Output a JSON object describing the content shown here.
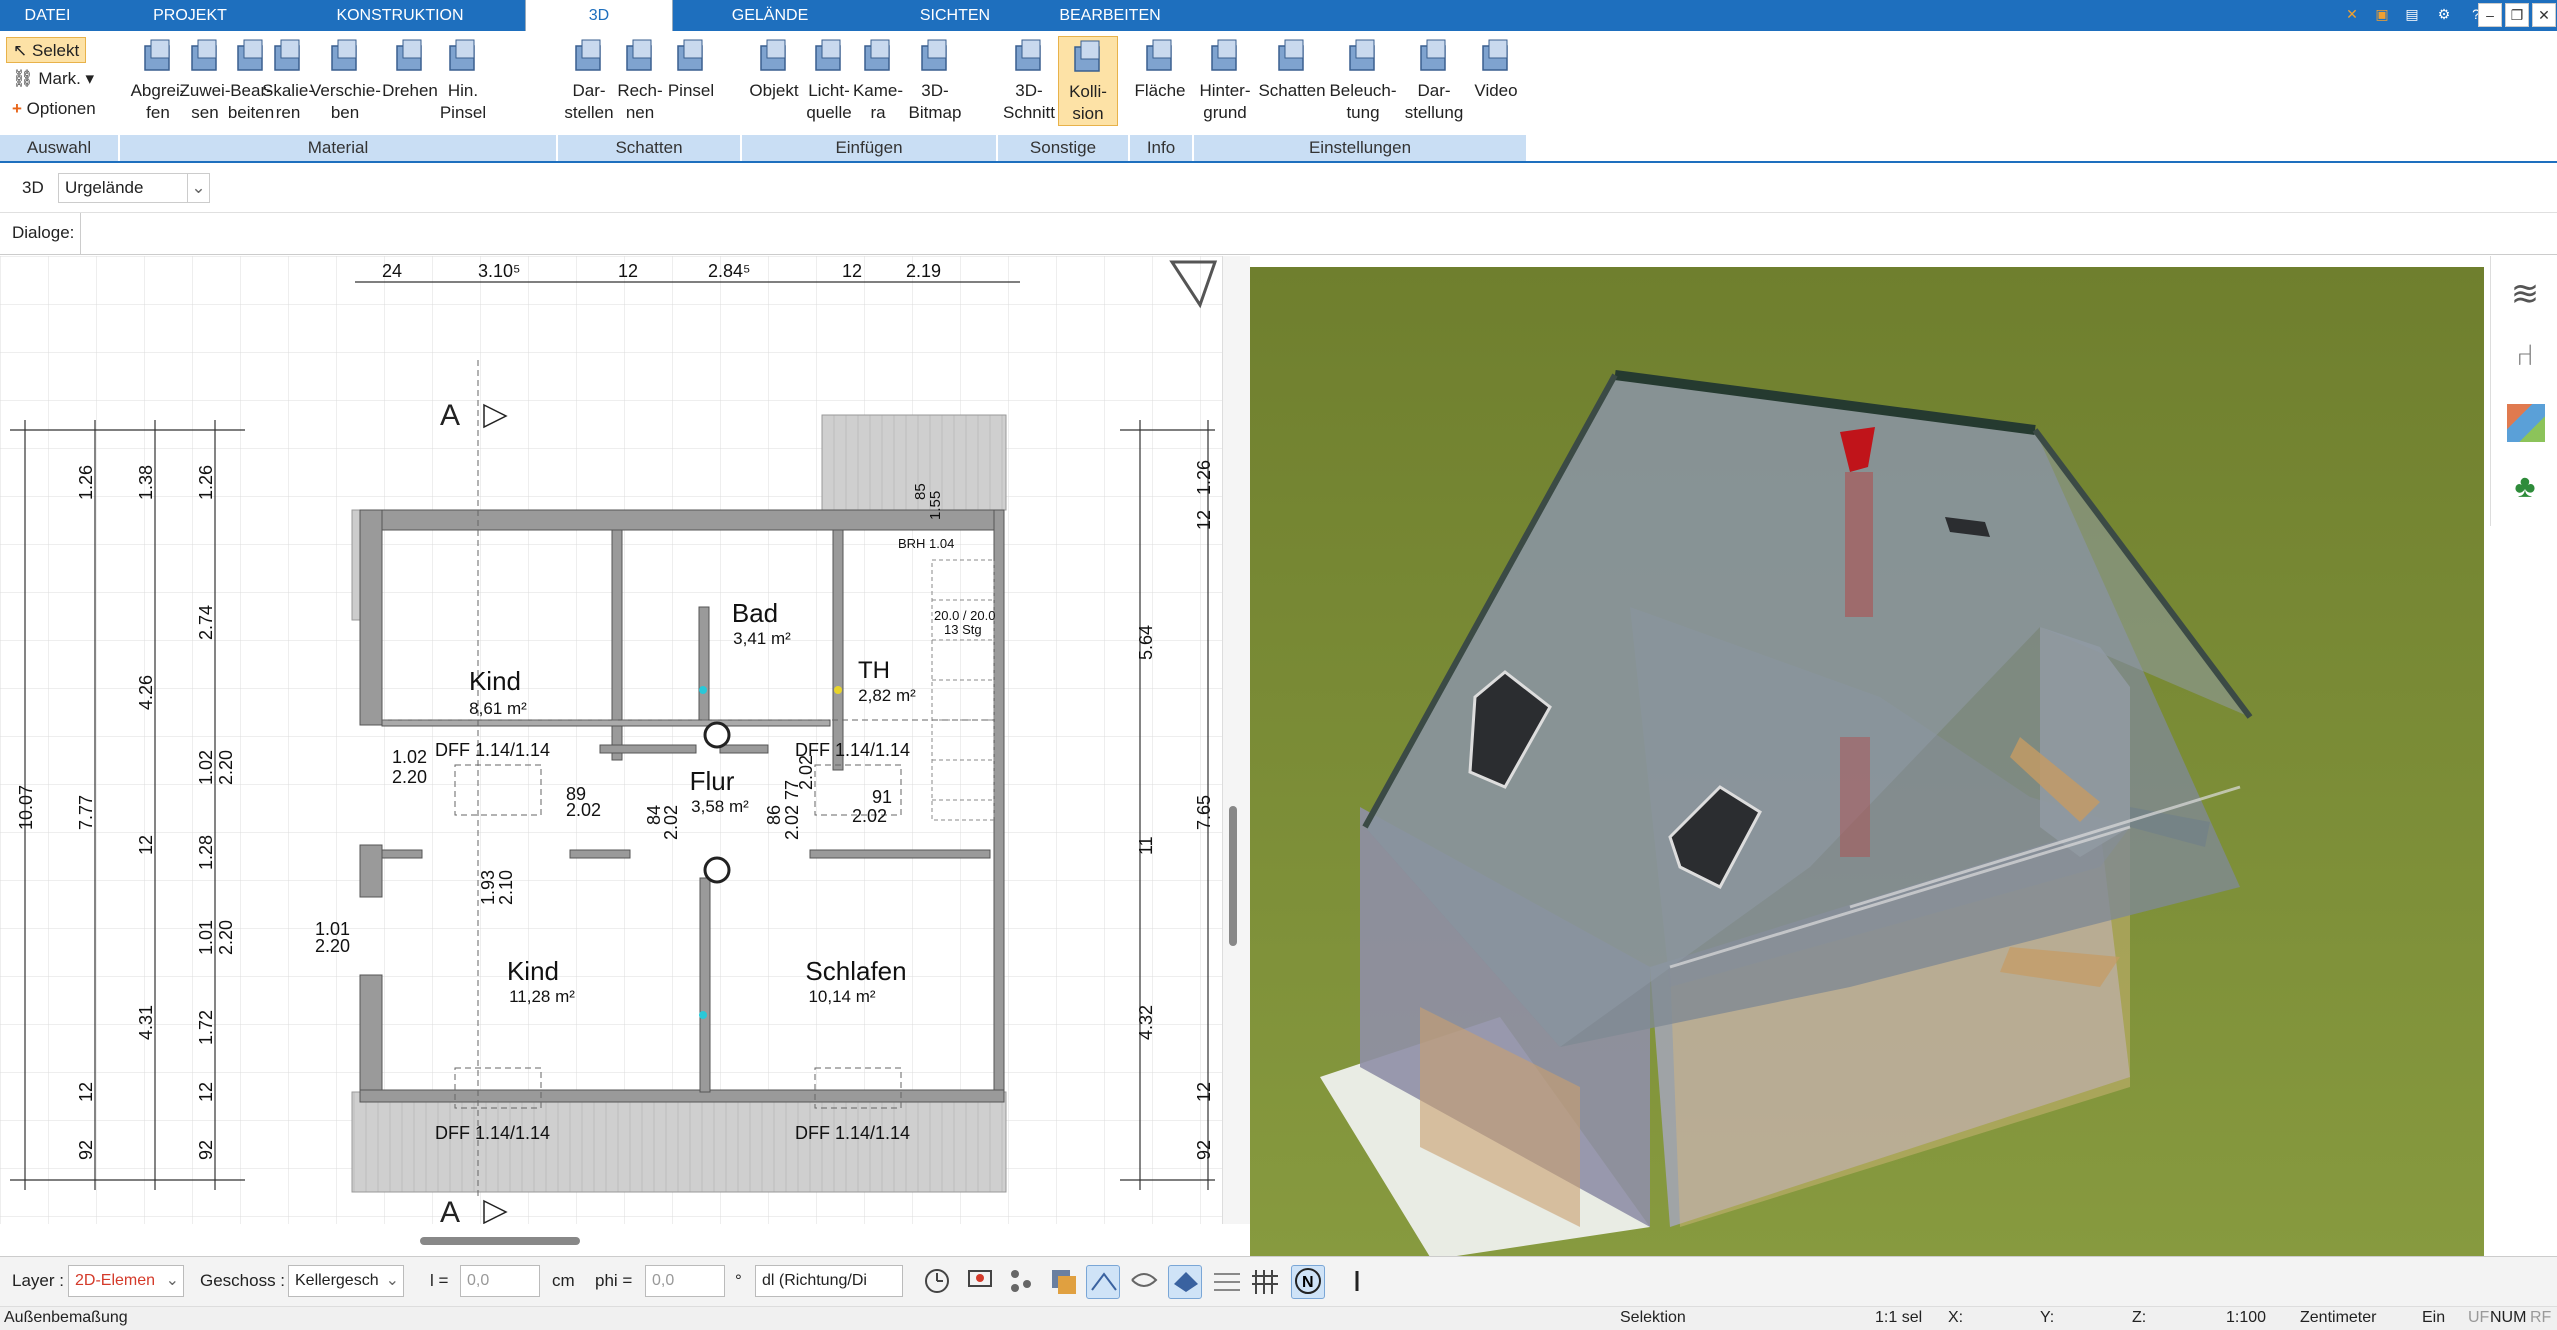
{
  "menubar": {
    "tabs": [
      "DATEI",
      "PROJEKT",
      "KONSTRUKTION",
      "3D",
      "GELÄNDE",
      "SICHTEN",
      "BEARBEITEN"
    ],
    "active": "3D"
  },
  "ribbon": {
    "selection": {
      "select": "Selekt",
      "mark": "Mark.",
      "options": "Optionen"
    },
    "buttons": [
      {
        "label1": "Abgrei-",
        "label2": "fen",
        "icon": "pick-material-icon"
      },
      {
        "label1": "Zuwei-",
        "label2": "sen",
        "icon": "assign-material-icon"
      },
      {
        "label1": "Bear-",
        "label2": "beiten",
        "icon": "edit-material-icon"
      },
      {
        "label1": "Skalie-",
        "label2": "ren",
        "icon": "scale-material-icon"
      },
      {
        "label1": "Verschie-",
        "label2": "ben",
        "icon": "move-material-icon"
      },
      {
        "label1": "Drehen",
        "label2": "",
        "icon": "rotate-material-icon"
      },
      {
        "label1": "Hin.",
        "label2": "Pinsel",
        "icon": "brush-icon"
      },
      {
        "label1": "Dar-",
        "label2": "stellen",
        "icon": "shadow-display-icon"
      },
      {
        "label1": "Rech-",
        "label2": "nen",
        "icon": "shadow-compute-icon"
      },
      {
        "label1": "Pinsel",
        "label2": "",
        "icon": "shadow-brush-icon"
      },
      {
        "label1": "Objekt",
        "label2": "",
        "icon": "chair-icon"
      },
      {
        "label1": "Licht-",
        "label2": "quelle",
        "icon": "light-bulb-icon"
      },
      {
        "label1": "Kame-",
        "label2": "ra",
        "icon": "camera-icon"
      },
      {
        "label1": "3D-",
        "label2": "Bitmap",
        "icon": "tree-icon"
      },
      {
        "label1": "3D-",
        "label2": "Schnitt",
        "icon": "section-cut-icon"
      },
      {
        "label1": "Kolli-",
        "label2": "sion",
        "icon": "collision-icon"
      },
      {
        "label1": "Fläche",
        "label2": "",
        "icon": "area-info-icon"
      },
      {
        "label1": "Hinter-",
        "label2": "grund",
        "icon": "background-icon"
      },
      {
        "label1": "Schatten",
        "label2": "",
        "icon": "shadow-house-icon"
      },
      {
        "label1": "Beleuch-",
        "label2": "tung",
        "icon": "lighting-house-icon"
      },
      {
        "label1": "Dar-",
        "label2": "stellung",
        "icon": "display-settings-icon"
      },
      {
        "label1": "Video",
        "label2": "",
        "icon": "play-icon"
      }
    ],
    "groups": [
      "Auswahl",
      "Material",
      "Schatten",
      "Einfügen",
      "Sonstige",
      "Info",
      "Einstellungen"
    ]
  },
  "toolbar": {
    "view_label": "3D",
    "terrain_select": "Urgelände",
    "dialoge_label": "Dialoge:"
  },
  "plan": {
    "top_dims": [
      "24",
      "3.10⁵",
      "12",
      "2.84⁵",
      "12",
      "2.19"
    ],
    "left_dims": [
      "1.26",
      "1.38",
      "1.26",
      "2.74",
      "4.26",
      "1.02",
      "2.20",
      "10.07",
      "7.77",
      "12",
      "1.28",
      "1.01",
      "2.20",
      "4.31",
      "1.72",
      "12",
      "12",
      "92",
      "92"
    ],
    "right_dims": [
      "1.26",
      "12",
      "5.64",
      "7.65",
      "11",
      "4.32",
      "12",
      "92"
    ],
    "rooms": [
      {
        "name": "Kind",
        "area": "8,61 m²"
      },
      {
        "name": "Bad",
        "area": "3,41 m²"
      },
      {
        "name": "TH",
        "area": "2,82 m²"
      },
      {
        "name": "Flur",
        "area": "3,58 m²"
      },
      {
        "name": "Kind",
        "area": "11,28 m²"
      },
      {
        "name": "Schlafen",
        "area": "10,14 m²"
      }
    ],
    "labels": {
      "dff1": "DFF  1.14/1.14",
      "dff2": "DFF  1.14/1.14",
      "dff3": "DFF  1.14/1.14",
      "dff4": "DFF  1.14/1.14",
      "brh": "BRH 1.04",
      "stairs": "20.0 / 20.0",
      "stairs2": "13 Stg",
      "w1": "1.02",
      "w1b": "2.20",
      "d1": "89",
      "d1b": "2.02",
      "d2": "84",
      "d2b": "2.02",
      "d3": "86",
      "d3b": "2.02",
      "d4": "77",
      "d4b": "2.02",
      "d5": "91",
      "d5b": "2.02",
      "d6": "1.93",
      "d6b": "2.10",
      "w2": "1.01",
      "w2b": "2.20",
      "top1": "1.55",
      "top2": "85",
      "section": "A"
    }
  },
  "bottombar": {
    "layer_label": "Layer :",
    "layer_value": "2D-Elemen",
    "floor_label": "Geschoss :",
    "floor_value": "Kellergesch",
    "l_label": "l =",
    "l_value": "0,0",
    "cm": "cm",
    "phi_label": "phi =",
    "phi_value": "0,0",
    "deg": "°",
    "direction": "dl (Richtung/Di"
  },
  "status": {
    "left": "Außenbemaßung",
    "mode": "Selektion",
    "sel": "1:1 sel",
    "x": "X:",
    "y": "Y:",
    "z": "Z:",
    "scale": "1:100",
    "unit": "Zentimeter",
    "ein": "Ein",
    "uf": "UF",
    "num": "NUM",
    "rf": "RF"
  }
}
